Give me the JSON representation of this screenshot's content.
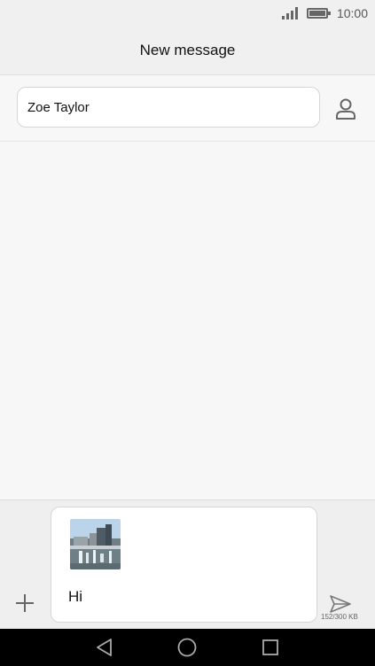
{
  "status_bar": {
    "time": "10:00",
    "signal_icon": "signal-icon",
    "battery_icon": "battery-icon"
  },
  "header": {
    "title": "New message"
  },
  "recipient": {
    "value": "Zoe Taylor",
    "contact_icon": "person-icon"
  },
  "composer": {
    "attachment_icon": "image-thumbnail",
    "message_text": "Hi",
    "add_icon": "plus-icon",
    "send_icon": "send-icon",
    "size_label": "152/300 KB"
  },
  "nav_bar": {
    "back_icon": "back-icon",
    "home_icon": "home-icon",
    "recent_icon": "recent-apps-icon"
  }
}
